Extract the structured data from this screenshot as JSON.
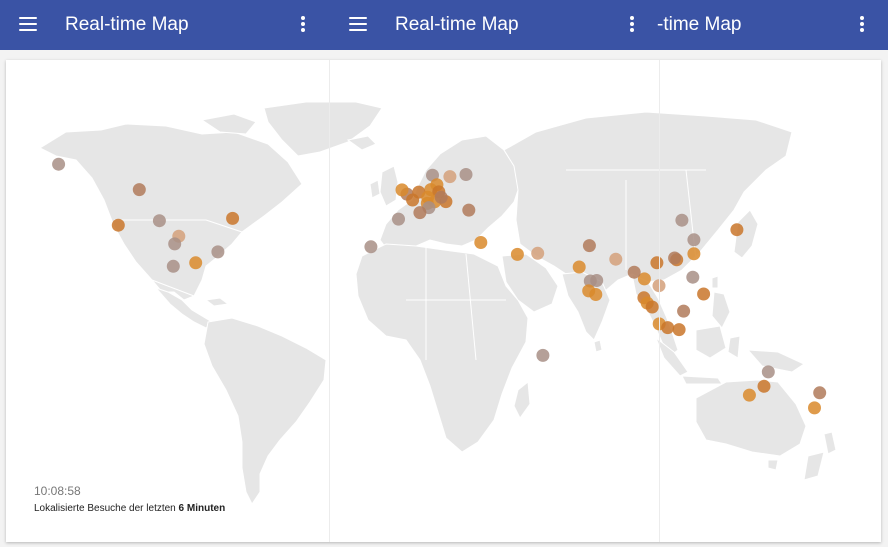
{
  "header": {
    "segments": [
      {
        "title": "Real-time Map",
        "menu_icon": "menu-icon",
        "more_icon": "more-vert-icon"
      },
      {
        "title": "Real-time Map",
        "menu_icon": "menu-icon",
        "more_icon": "more-vert-icon"
      },
      {
        "title": "-time Map",
        "more_icon": "more-vert-icon"
      }
    ]
  },
  "map": {
    "land_color": "#e6e6e6",
    "marker_colors": [
      "#d98a2b",
      "#c9752a",
      "#b07a5a",
      "#a88f86",
      "#d4a07a"
    ],
    "markers": [
      {
        "lat": 64.8,
        "lon": -147.7,
        "color": "#a88f86"
      },
      {
        "lat": 53.5,
        "lon": -113.5,
        "color": "#b07a5a"
      },
      {
        "lat": 37.7,
        "lon": -122.4,
        "color": "#c9752a"
      },
      {
        "lat": 39.7,
        "lon": -105.0,
        "color": "#a88f86"
      },
      {
        "lat": 40.7,
        "lon": -74.0,
        "color": "#c9752a"
      },
      {
        "lat": 32.8,
        "lon": -96.8,
        "color": "#d4a07a"
      },
      {
        "lat": 29.4,
        "lon": -98.5,
        "color": "#a88f86"
      },
      {
        "lat": 25.8,
        "lon": -80.2,
        "color": "#a88f86"
      },
      {
        "lat": 19.4,
        "lon": -99.1,
        "color": "#a88f86"
      },
      {
        "lat": 21.0,
        "lon": -89.6,
        "color": "#d98a2b"
      },
      {
        "lat": 28.1,
        "lon": -15.4,
        "color": "#a88f86"
      },
      {
        "lat": 59.9,
        "lon": 10.7,
        "color": "#a88f86"
      },
      {
        "lat": 59.3,
        "lon": 18.1,
        "color": "#d4a07a"
      },
      {
        "lat": 60.2,
        "lon": 24.9,
        "color": "#a88f86"
      },
      {
        "lat": 55.7,
        "lon": 12.6,
        "color": "#d98a2b"
      },
      {
        "lat": 53.5,
        "lon": 10.0,
        "color": "#d98a2b"
      },
      {
        "lat": 52.5,
        "lon": 13.4,
        "color": "#c9752a"
      },
      {
        "lat": 51.5,
        "lon": -0.1,
        "color": "#b07a5a"
      },
      {
        "lat": 53.4,
        "lon": -2.2,
        "color": "#d98a2b"
      },
      {
        "lat": 52.4,
        "lon": 4.9,
        "color": "#c9752a"
      },
      {
        "lat": 50.1,
        "lon": 8.7,
        "color": "#d98a2b"
      },
      {
        "lat": 48.9,
        "lon": 2.3,
        "color": "#c9752a"
      },
      {
        "lat": 48.1,
        "lon": 11.6,
        "color": "#d98a2b"
      },
      {
        "lat": 47.4,
        "lon": 8.5,
        "color": "#d98a2b"
      },
      {
        "lat": 48.2,
        "lon": 16.4,
        "color": "#c9752a"
      },
      {
        "lat": 50.1,
        "lon": 14.4,
        "color": "#b07a5a"
      },
      {
        "lat": 45.5,
        "lon": 9.2,
        "color": "#a88f86"
      },
      {
        "lat": 43.3,
        "lon": 5.4,
        "color": "#b07a5a"
      },
      {
        "lat": 40.4,
        "lon": -3.7,
        "color": "#a88f86"
      },
      {
        "lat": 44.4,
        "lon": 26.1,
        "color": "#b07a5a"
      },
      {
        "lat": 30.0,
        "lon": 31.2,
        "color": "#d98a2b"
      },
      {
        "lat": 24.7,
        "lon": 46.7,
        "color": "#d98a2b"
      },
      {
        "lat": 25.2,
        "lon": 55.3,
        "color": "#d4a07a"
      },
      {
        "lat": 28.6,
        "lon": 77.2,
        "color": "#b07a5a"
      },
      {
        "lat": 19.1,
        "lon": 72.9,
        "color": "#d98a2b"
      },
      {
        "lat": 22.6,
        "lon": 88.4,
        "color": "#d4a07a"
      },
      {
        "lat": 13.1,
        "lon": 80.3,
        "color": "#a88f86"
      },
      {
        "lat": 12.9,
        "lon": 77.6,
        "color": "#a88f86"
      },
      {
        "lat": 6.9,
        "lon": 79.9,
        "color": "#d98a2b"
      },
      {
        "lat": 8.5,
        "lon": 76.9,
        "color": "#d98a2b"
      },
      {
        "lat": 39.9,
        "lon": 116.4,
        "color": "#a88f86"
      },
      {
        "lat": 31.2,
        "lon": 121.5,
        "color": "#a88f86"
      },
      {
        "lat": 35.7,
        "lon": 139.7,
        "color": "#c9752a"
      },
      {
        "lat": 22.3,
        "lon": 114.2,
        "color": "#c9752a"
      },
      {
        "lat": 23.1,
        "lon": 113.3,
        "color": "#b07a5a"
      },
      {
        "lat": 25.0,
        "lon": 121.5,
        "color": "#d98a2b"
      },
      {
        "lat": 21.0,
        "lon": 105.8,
        "color": "#c9752a"
      },
      {
        "lat": 13.8,
        "lon": 100.5,
        "color": "#d98a2b"
      },
      {
        "lat": 16.8,
        "lon": 96.2,
        "color": "#b07a5a"
      },
      {
        "lat": 14.6,
        "lon": 121.0,
        "color": "#a88f86"
      },
      {
        "lat": 10.8,
        "lon": 106.7,
        "color": "#d4a07a"
      },
      {
        "lat": 7.1,
        "lon": 125.6,
        "color": "#c9752a"
      },
      {
        "lat": 5.4,
        "lon": 100.3,
        "color": "#c9752a"
      },
      {
        "lat": 3.1,
        "lon": 101.7,
        "color": "#d98a2b"
      },
      {
        "lat": 1.35,
        "lon": 103.8,
        "color": "#c9752a"
      },
      {
        "lat": -0.5,
        "lon": 117.1,
        "color": "#b07a5a"
      },
      {
        "lat": -6.2,
        "lon": 106.8,
        "color": "#d98a2b"
      },
      {
        "lat": -7.8,
        "lon": 110.4,
        "color": "#c9752a"
      },
      {
        "lat": -8.7,
        "lon": 115.2,
        "color": "#c9752a"
      },
      {
        "lat": -20.2,
        "lon": 57.5,
        "color": "#a88f86"
      },
      {
        "lat": -27.5,
        "lon": 153.0,
        "color": "#a88f86"
      },
      {
        "lat": -33.9,
        "lon": 151.2,
        "color": "#c9752a"
      },
      {
        "lat": -37.8,
        "lon": 145.0,
        "color": "#d98a2b"
      },
      {
        "lat": -36.8,
        "lon": 174.8,
        "color": "#b07a5a"
      },
      {
        "lat": -43.5,
        "lon": 172.6,
        "color": "#d98a2b"
      }
    ]
  },
  "status": {
    "time": "10:08:58",
    "caption_prefix": "Lokalisierte Besuche der letzten ",
    "caption_bold": "6 Minuten"
  }
}
